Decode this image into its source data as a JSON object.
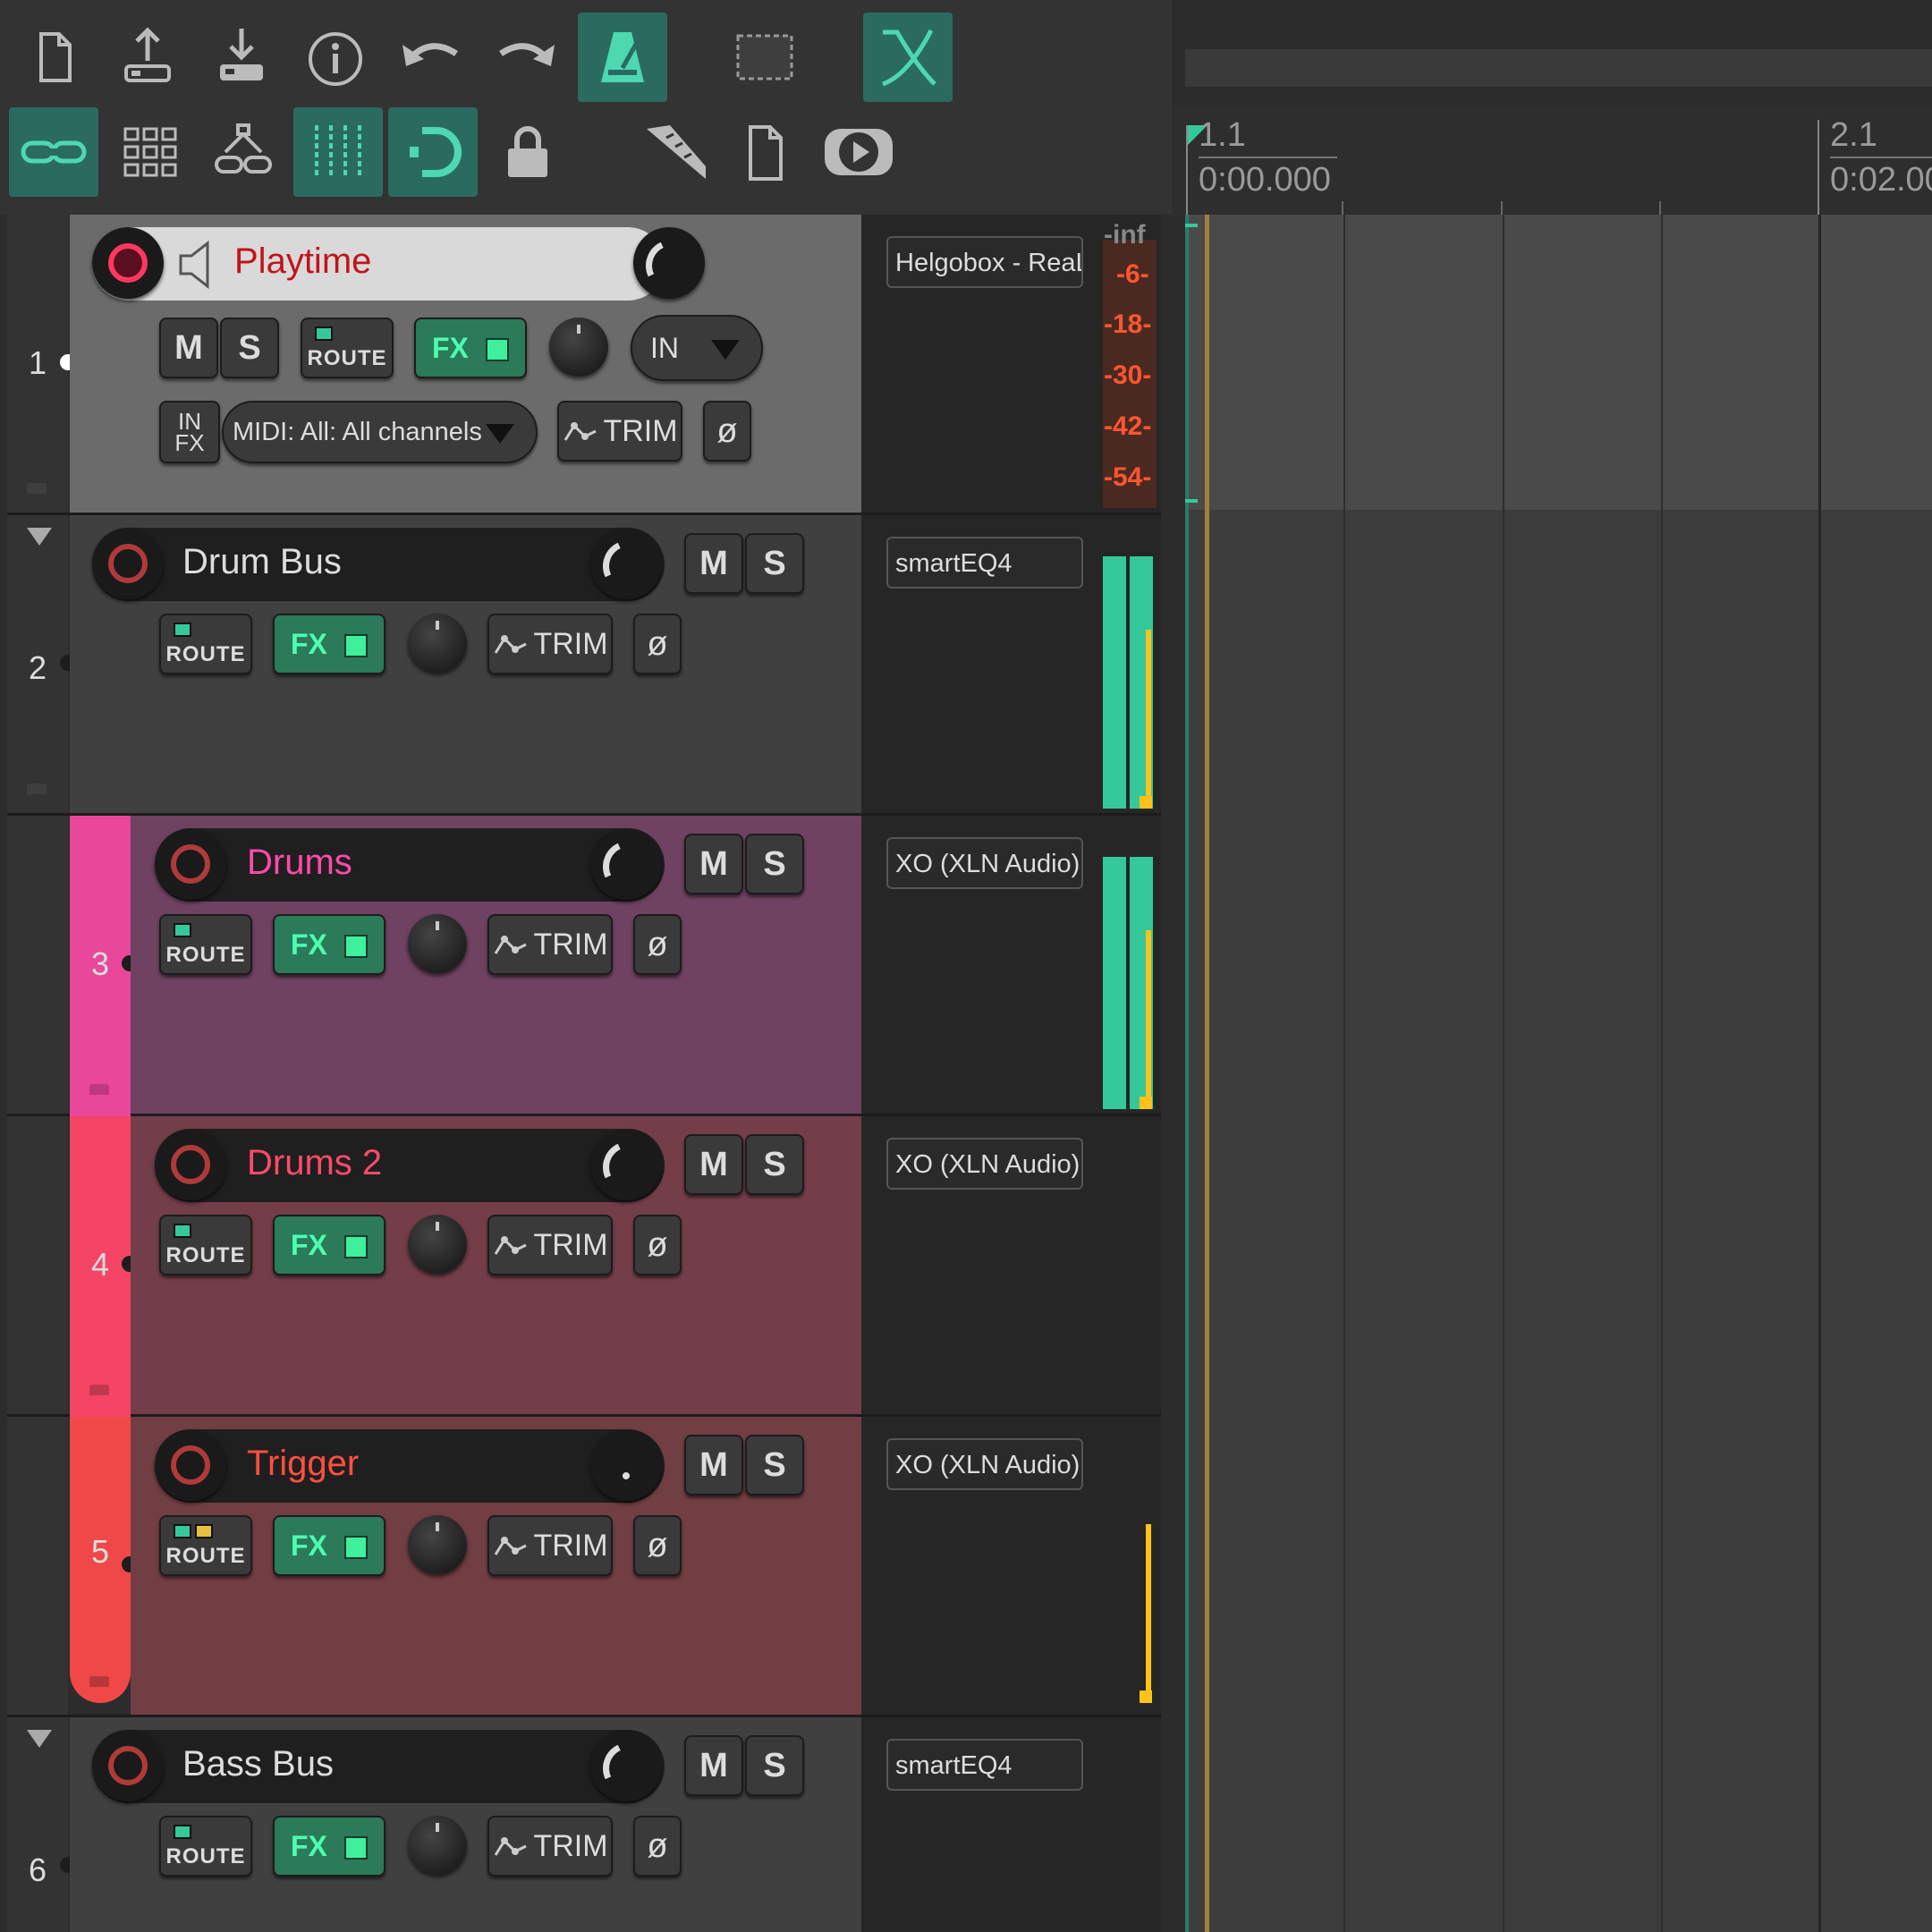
{
  "ruler": {
    "marker1_bar": "1.1",
    "marker1_time": "0:00.000",
    "marker2_bar": "2.1",
    "marker2_time": "0:02.00"
  },
  "toolbar": {
    "row1": [
      "new-project-icon",
      "save-upload-icon",
      "download-icon",
      "info-icon",
      "undo-icon",
      "redo-icon",
      "metronome-icon",
      "marquee-select-icon",
      "crossfade-icon"
    ],
    "row2": [
      "link-icon",
      "grid-snap-icon",
      "group-link-icon",
      "grid-lines-icon",
      "loop-icon",
      "lock-icon",
      "ruler-icon",
      "document-icon",
      "transport-play-icon"
    ],
    "accent": "#2b6b5f"
  },
  "tracks": [
    {
      "number": "1",
      "name": "Playtime",
      "name_color": "#c0141c",
      "color": "#6b6b6b",
      "selected": true,
      "fx_slot": "Helgobox - ReaL",
      "m": "M",
      "s": "S",
      "route": "ROUTE",
      "fx": "FX",
      "trim": "TRIM",
      "phase": "ø",
      "input": "IN",
      "infx": "IN FX",
      "midi_input": "MIDI: All: All channels",
      "meter_scale": [
        "-inf",
        "-6-",
        "-18-",
        "-30-",
        "-42-",
        "-54-"
      ]
    },
    {
      "number": "2",
      "name": "Drum Bus",
      "name_color": "#dddddd",
      "color": "#404040",
      "fx_slot": "smartEQ4",
      "m": "M",
      "s": "S",
      "route": "ROUTE",
      "fx": "FX",
      "trim": "TRIM",
      "phase": "ø"
    },
    {
      "number": "3",
      "name": "Drums",
      "name_color": "#ff4aa8",
      "color": "#6e4260",
      "strip": "#e8479a",
      "fx_slot": "XO (XLN Audio)",
      "m": "M",
      "s": "S",
      "route": "ROUTE",
      "fx": "FX",
      "trim": "TRIM",
      "phase": "ø"
    },
    {
      "number": "4",
      "name": "Drums 2",
      "name_color": "#ff4a6a",
      "color": "#733e4a",
      "strip": "#f44565",
      "fx_slot": "XO (XLN Audio)",
      "m": "M",
      "s": "S",
      "route": "ROUTE",
      "fx": "FX",
      "trim": "TRIM",
      "phase": "ø"
    },
    {
      "number": "5",
      "name": "Trigger",
      "name_color": "#ff5040",
      "color": "#713e43",
      "strip": "#f04848",
      "fx_slot": "XO (XLN Audio)",
      "m": "M",
      "s": "S",
      "route": "ROUTE",
      "fx": "FX",
      "trim": "TRIM",
      "phase": "ø"
    },
    {
      "number": "6",
      "name": "Bass Bus",
      "name_color": "#dddddd",
      "color": "#404040",
      "fx_slot": "smartEQ4",
      "m": "M",
      "s": "S",
      "route": "ROUTE",
      "fx": "FX",
      "trim": "TRIM",
      "phase": "ø"
    }
  ]
}
